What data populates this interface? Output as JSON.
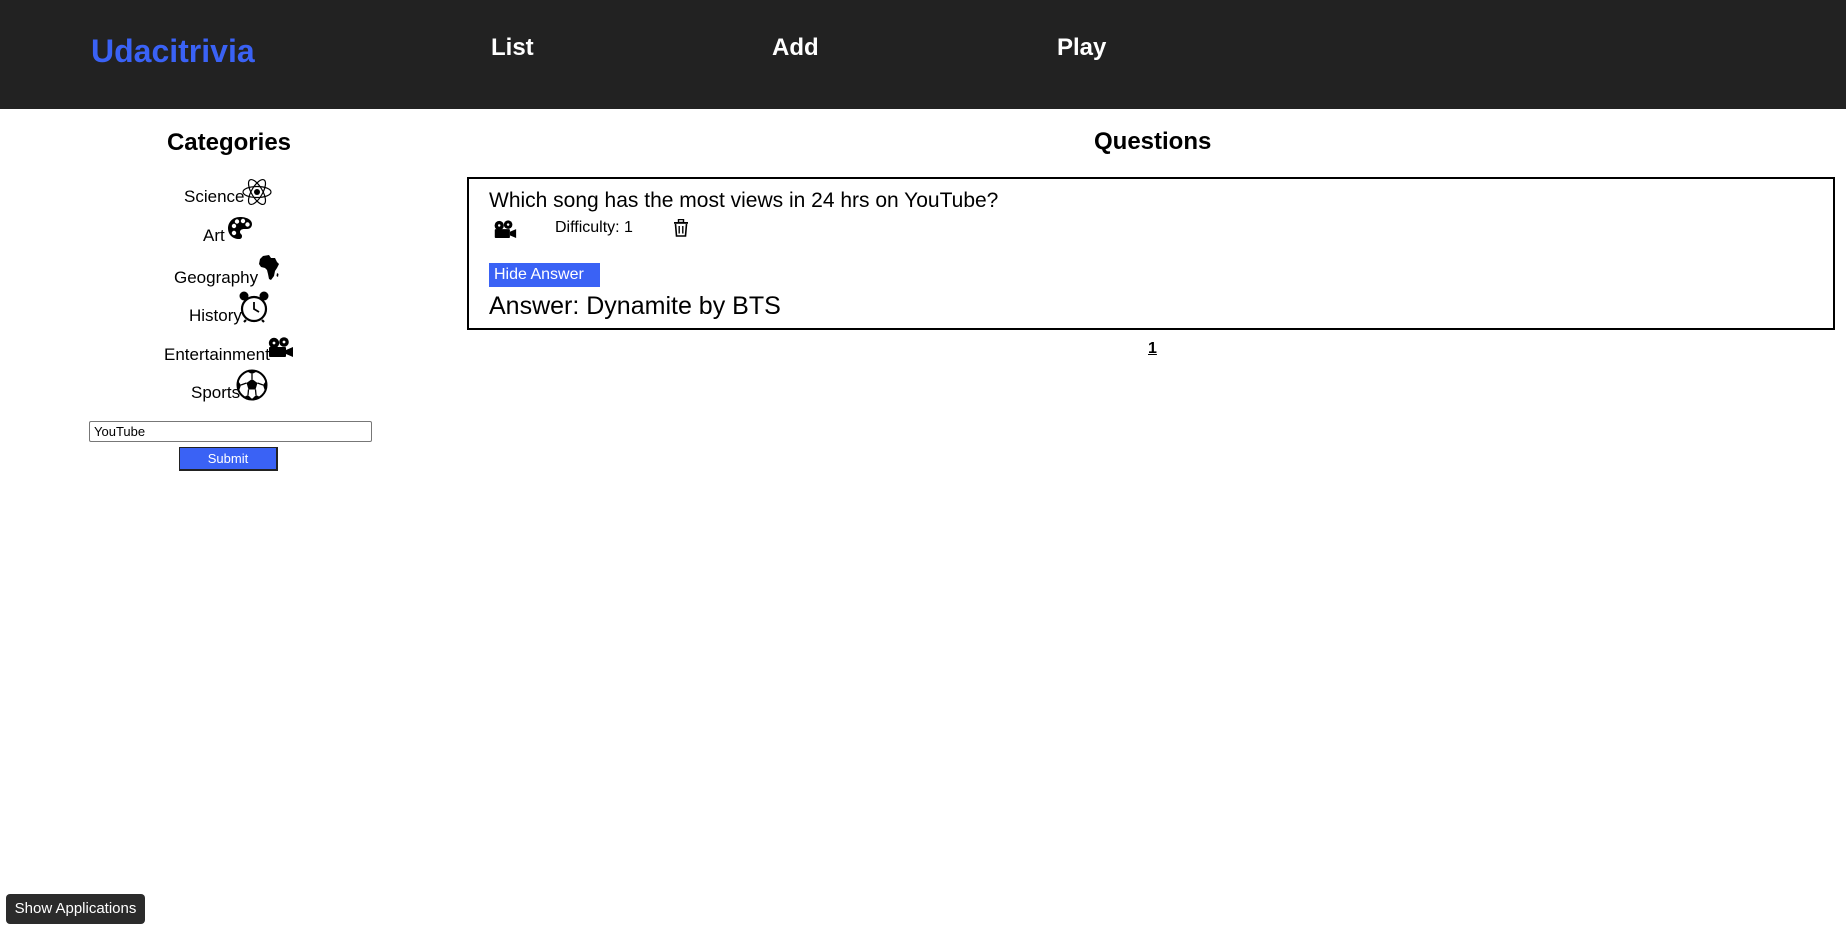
{
  "header": {
    "brand": "Udacitrivia",
    "nav": {
      "list": "List",
      "add": "Add",
      "play": "Play"
    }
  },
  "sidebar": {
    "title": "Categories",
    "categories": [
      {
        "label": "Science",
        "icon": "science-atom-icon"
      },
      {
        "label": "Art",
        "icon": "art-palette-icon"
      },
      {
        "label": "Geography",
        "icon": "geography-africa-icon"
      },
      {
        "label": "History",
        "icon": "history-alarm-clock-icon"
      },
      {
        "label": "Entertainment",
        "icon": "entertainment-film-camera-icon"
      },
      {
        "label": "Sports",
        "icon": "sports-soccer-ball-icon"
      }
    ],
    "search": {
      "value": "YouTube",
      "submit_label": "Submit"
    }
  },
  "main": {
    "title": "Questions",
    "questions": [
      {
        "question": "Which song has the most views in 24 hrs on YouTube?",
        "category_icon": "entertainment-film-camera-icon",
        "difficulty": "Difficulty: 1",
        "hide_answer_label": "Hide Answer",
        "answer": "Answer: Dynamite by BTS"
      }
    ],
    "pagination": [
      "1"
    ]
  },
  "taskbar": {
    "show_apps_label": "Show Applications"
  },
  "colors": {
    "accent": "#3a62f5",
    "header_bg": "#222222"
  }
}
